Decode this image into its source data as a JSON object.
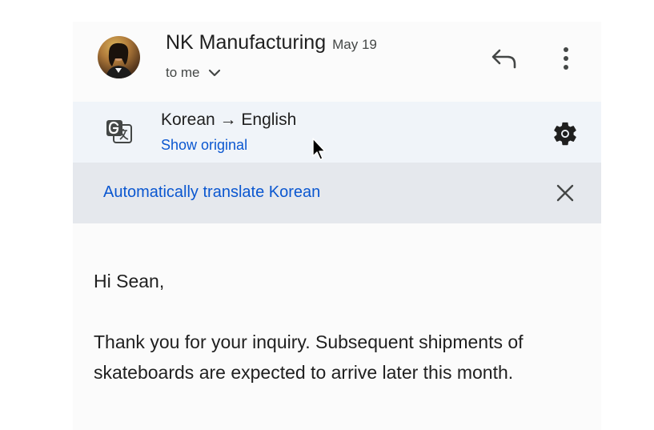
{
  "header": {
    "sender": "NK Manufacturing",
    "date": "May 19",
    "recipient": "to me",
    "avatar_icon": "avatar-photo",
    "reply_icon": "reply-icon",
    "more_icon": "more-vert-icon"
  },
  "translation": {
    "language_pair": "Korean → English",
    "show_original": "Show original",
    "translate_icon": "translate-icon",
    "settings_icon": "settings-gear-icon"
  },
  "auto_translate": {
    "label": "Automatically translate Korean",
    "close_icon": "close-icon"
  },
  "message": {
    "greeting": "Hi Sean,",
    "paragraph": "Thank you for your inquiry. Subsequent shipments of skateboards are expected to arrive later this month."
  },
  "colors": {
    "link": "#0b57d0",
    "text": "#1f1f1f",
    "secondary_text": "#444746",
    "translate_bar_bg": "#f0f4f9",
    "auto_bar_bg": "#e5e8ed"
  }
}
